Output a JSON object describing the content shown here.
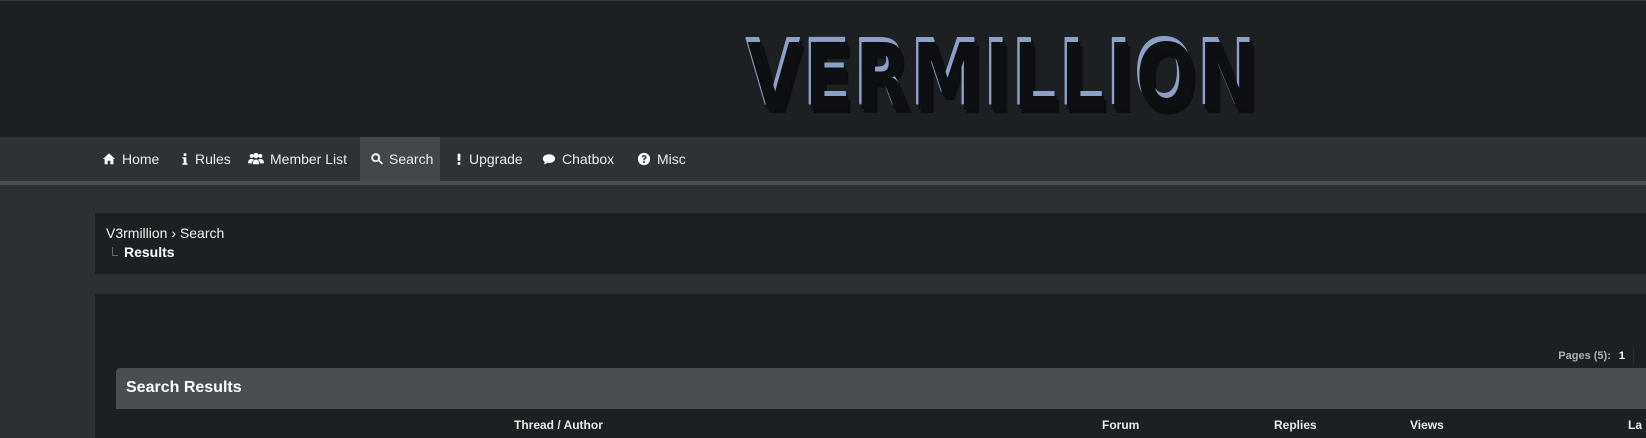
{
  "header": {
    "logo_text": "VERMILLION",
    "logo_color": "#5a6f9c"
  },
  "nav": {
    "items": [
      {
        "label": "Home",
        "icon": "home-icon"
      },
      {
        "label": "Rules",
        "icon": "info-icon"
      },
      {
        "label": "Member List",
        "icon": "users-icon"
      },
      {
        "label": "Search",
        "icon": "search-icon",
        "active": true
      },
      {
        "label": "Upgrade",
        "icon": "exclamation-icon"
      },
      {
        "label": "Chatbox",
        "icon": "comment-icon"
      },
      {
        "label": "Misc",
        "icon": "question-circle-icon"
      }
    ]
  },
  "breadcrumb": {
    "root": "V3rmillion",
    "separator": "›",
    "parent": "Search",
    "current": "Results"
  },
  "pagination": {
    "label": "Pages (5):",
    "current": "1"
  },
  "results": {
    "title": "Search Results",
    "columns": {
      "thread_author": "Thread / Author",
      "forum": "Forum",
      "replies": "Replies",
      "views": "Views",
      "last_post": "La"
    }
  },
  "colors": {
    "background": "#2c2f33",
    "header_bg": "#1d2023",
    "nav_bg": "#2e3135",
    "nav_active": "#43464b",
    "panel_head": "#4a4d52"
  }
}
